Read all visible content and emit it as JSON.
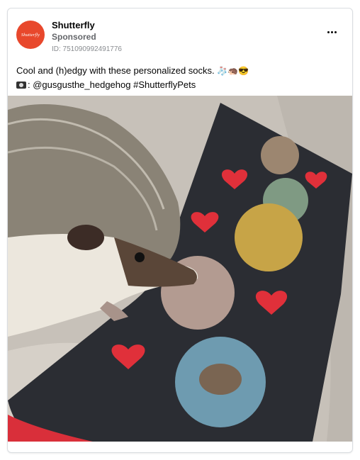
{
  "post": {
    "advertiser": "Shutterfly",
    "avatar_text": "Shutterfly",
    "sponsored_label": "Sponsored",
    "ad_id": "ID: 751090992491776",
    "caption_line1": "Cool and (h)edgy with these personalized socks.",
    "caption_line1_emojis": "🧦🦔😎",
    "caption_line2": ": @gusgusthe_hedgehog #ShutterflyPets",
    "more_icon": "more-options-icon"
  },
  "colors": {
    "brand": "#e8482c",
    "sock": "#2b2d33",
    "heart": "#e0303a",
    "blanket": "#c7c1b9"
  }
}
